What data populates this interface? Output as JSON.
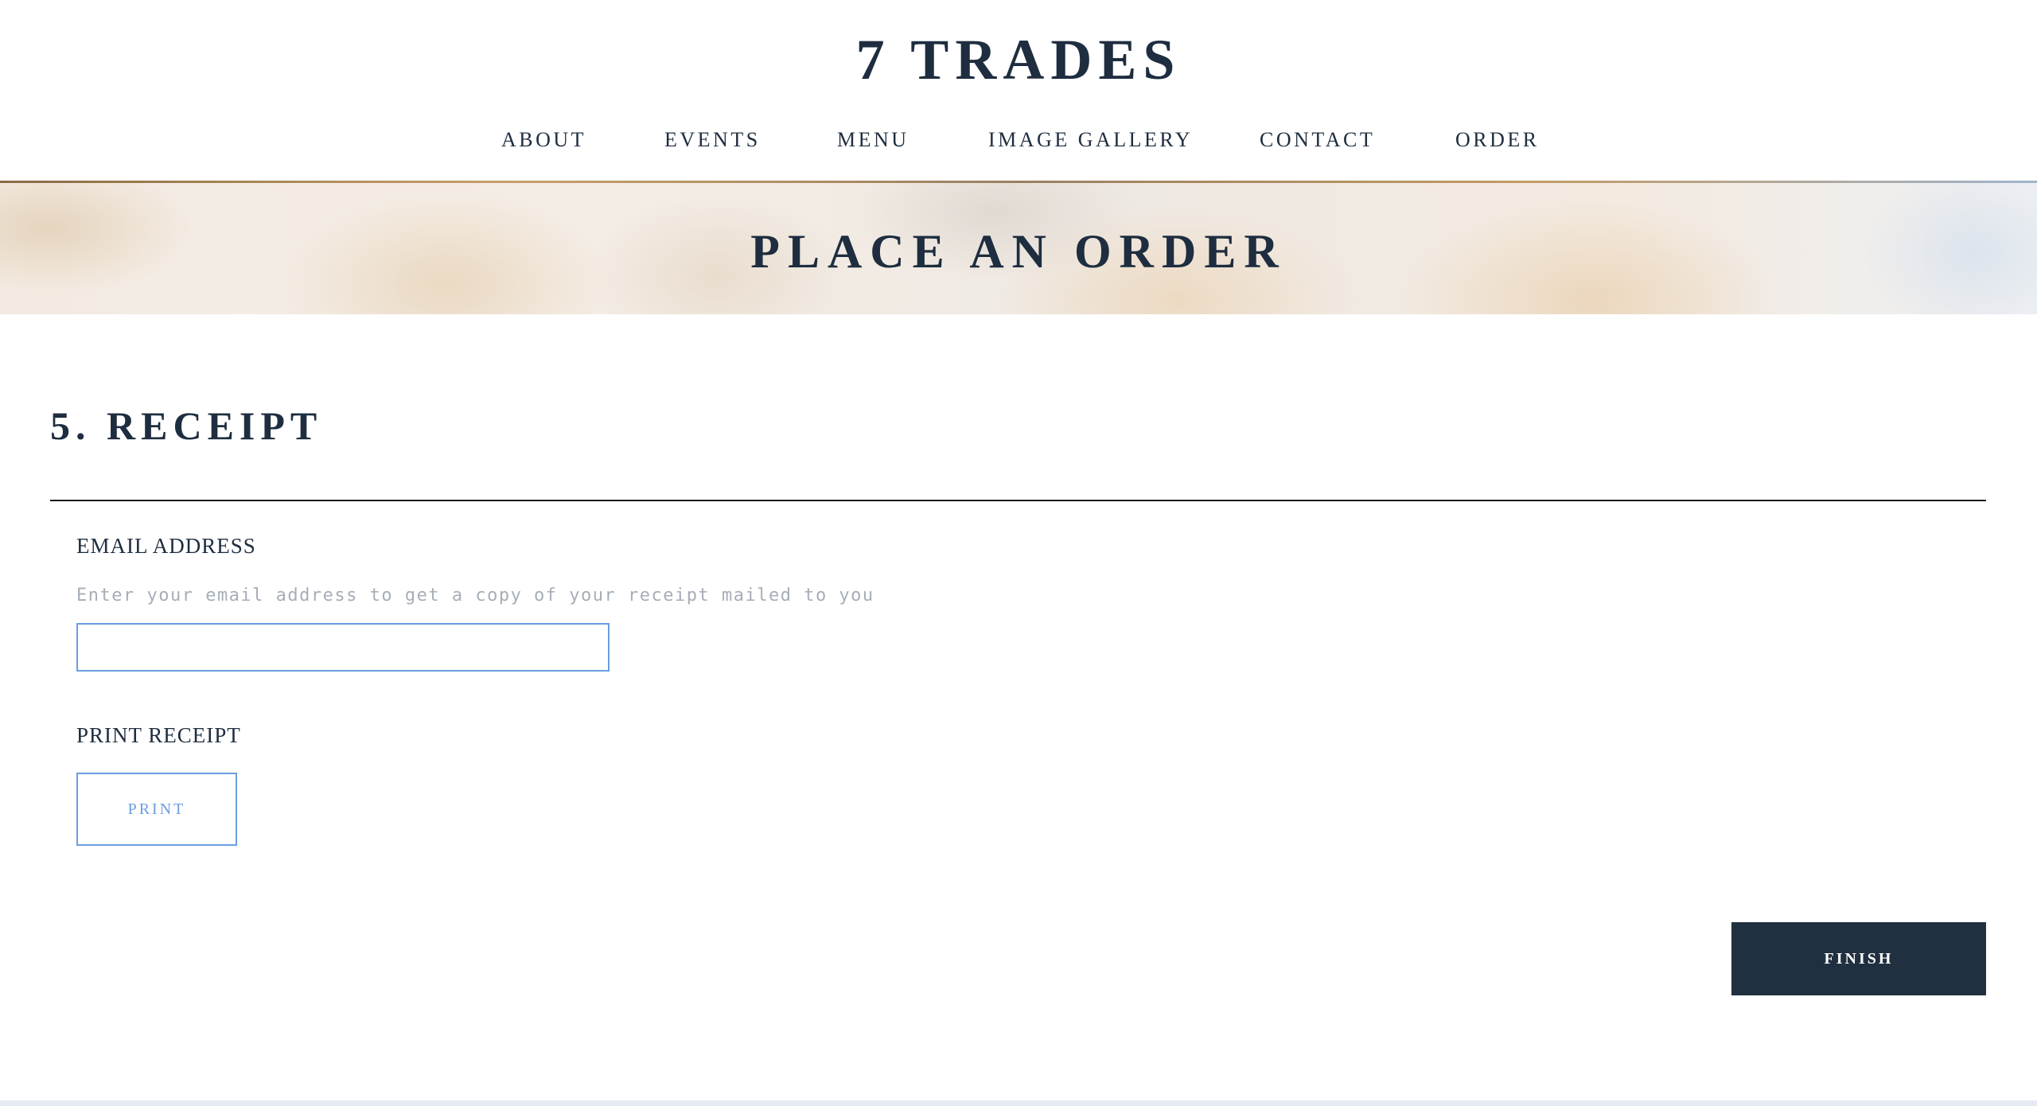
{
  "header": {
    "logo": "7 TRADES",
    "nav": [
      "ABOUT",
      "EVENTS",
      "MENU",
      "IMAGE GALLERY",
      "CONTACT",
      "ORDER"
    ]
  },
  "hero": {
    "title": "PLACE AN ORDER"
  },
  "section": {
    "title": "5. RECEIPT"
  },
  "email": {
    "label": "EMAIL ADDRESS",
    "helper": "Enter your email address to get a copy of your receipt mailed to you",
    "value": ""
  },
  "print": {
    "label": "PRINT RECEIPT",
    "button": "PRINT"
  },
  "finish": {
    "button": "FINISH"
  },
  "colors": {
    "navy": "#1e2d3f",
    "button_dark": "#203040",
    "accent_blue": "#6a9ee0",
    "helper_gray": "#a6aeb8"
  }
}
